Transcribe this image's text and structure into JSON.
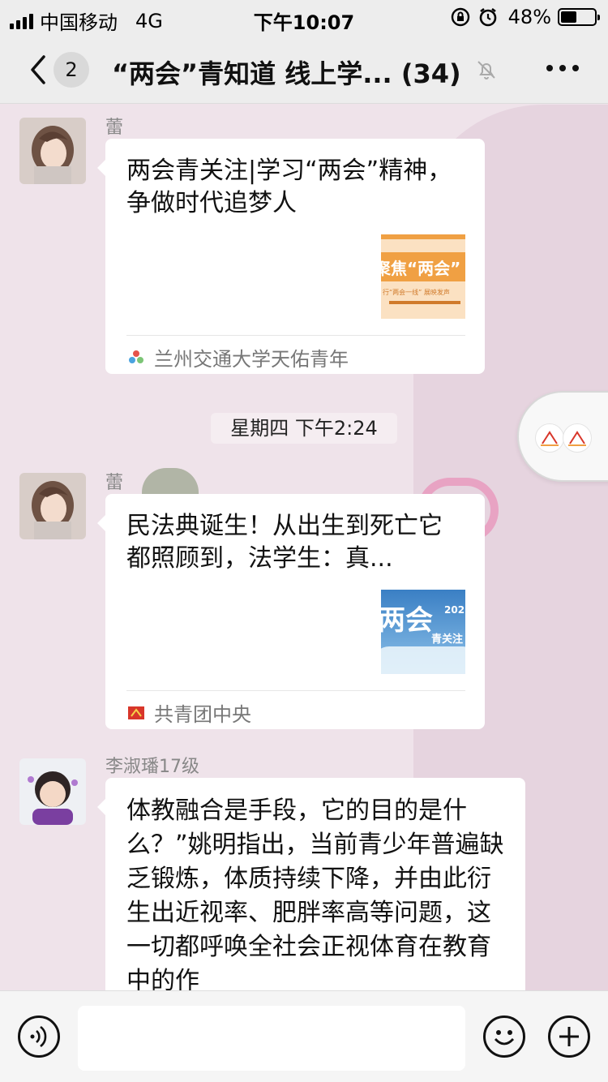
{
  "status_bar": {
    "carrier": "中国移动",
    "network": "4G",
    "time": "下午10:07",
    "battery_text": "48%",
    "battery_level": 0.48
  },
  "nav": {
    "badge_count": "2",
    "title": "“两会”青知道 线上学... (34)"
  },
  "messages": [
    {
      "sender": "蕾",
      "card_title": "两会青关注|学习“两会”精神，争做时代追梦人",
      "thumb_text": "聚焦“两会”",
      "thumb_subtext": "行“两会一线” 展映发声",
      "source": "兰州交通大学天佑青年"
    },
    {
      "sender": "蕾",
      "card_title": "民法典诞生！从出生到死亡它都照顾到，法学生：真...",
      "thumb_text": "两会",
      "thumb_subtext": "青关注",
      "thumb_year": "202",
      "source": "共青团中央"
    },
    {
      "sender": "李淑璠17级",
      "text": "体教融合是手段，它的目的是什么？”姚明指出，当前青少年普遍缺乏锻炼，体质持续下降，并由此衍生出近视率、肥胖率高等问题，这一切都呼唤全社会正视体育在教育中的作"
    }
  ],
  "time_divider": "星期四 下午2:24",
  "colors": {
    "chat_bg": "#efe3ea",
    "bar_bg": "#ededed",
    "bubble_bg": "#ffffff",
    "accent_orange": "#f0a043",
    "accent_blue": "#3a7fc4"
  },
  "icons": {
    "back": "chevron-left-icon",
    "mute": "bell-slash-icon",
    "more": "ellipsis-icon",
    "voice": "voice-icon",
    "emoji": "smiley-icon",
    "plus": "plus-icon"
  }
}
